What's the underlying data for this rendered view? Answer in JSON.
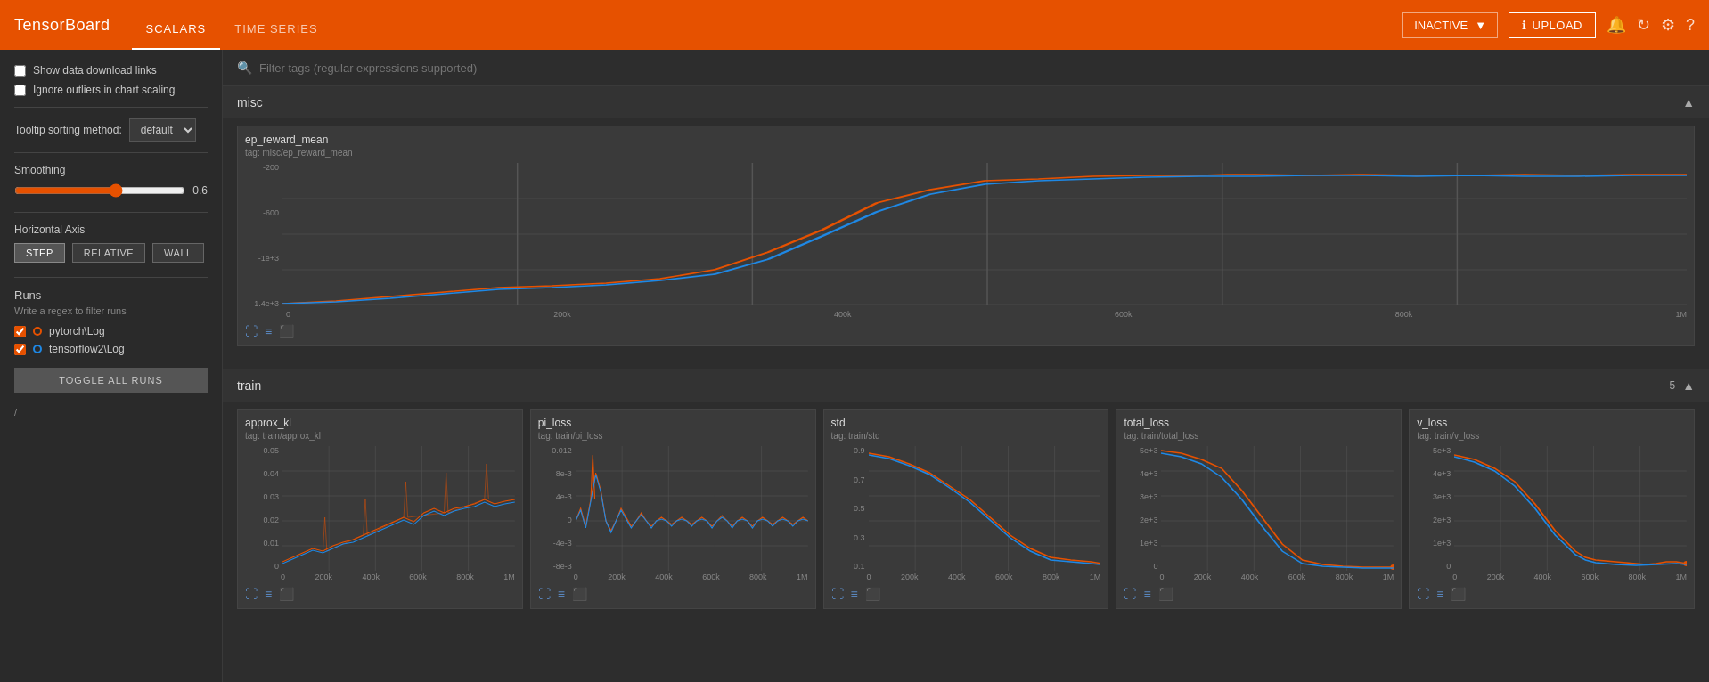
{
  "topnav": {
    "brand": "TensorBoard",
    "tabs": [
      {
        "label": "SCALARS",
        "active": true
      },
      {
        "label": "TIME SERIES",
        "active": false
      }
    ],
    "inactive_label": "INACTIVE",
    "upload_label": "UPLOAD",
    "icons": [
      "notification-icon",
      "refresh-icon",
      "settings-icon",
      "help-icon"
    ]
  },
  "sidebar": {
    "show_download": "Show data download links",
    "ignore_outliers": "Ignore outliers in chart scaling",
    "tooltip_label": "Tooltip sorting method:",
    "tooltip_value": "default",
    "smoothing_label": "Smoothing",
    "smoothing_value": "0.6",
    "haxis_label": "Horizontal Axis",
    "haxis_buttons": [
      "STEP",
      "RELATIVE",
      "WALL"
    ],
    "haxis_active": "STEP",
    "runs_title": "Runs",
    "runs_subtitle": "Write a regex to filter runs",
    "runs": [
      {
        "name": "pytorch\\Log",
        "color": "#e65100",
        "checked": true
      },
      {
        "name": "tensorflow2\\Log",
        "color": "#1e88e5",
        "checked": true
      }
    ],
    "toggle_all_label": "TOGGLE ALL RUNS",
    "slash_label": "/"
  },
  "filter": {
    "placeholder": "Filter tags (regular expressions supported)"
  },
  "sections": [
    {
      "title": "misc",
      "count": "",
      "collapsed": false,
      "charts": [
        {
          "id": "ep_reward_mean",
          "title": "ep_reward_mean",
          "tag": "tag: misc/ep_reward_mean",
          "y_labels": [
            "-200",
            "-600",
            "-1e+3",
            "-1.4e+3"
          ],
          "x_labels": [
            "0",
            "200k",
            "400k",
            "600k",
            "800k",
            "1M"
          ],
          "wide": true
        }
      ]
    },
    {
      "title": "train",
      "count": "5",
      "collapsed": false,
      "charts": [
        {
          "id": "approx_kl",
          "title": "approx_kl",
          "tag": "tag: train/approx_kl",
          "y_labels": [
            "0.05",
            "0.04",
            "0.03",
            "0.02",
            "0.01",
            "0"
          ],
          "x_labels": [
            "0",
            "200k",
            "400k",
            "600k",
            "800k",
            "1M"
          ]
        },
        {
          "id": "pi_loss",
          "title": "pi_loss",
          "tag": "tag: train/pi_loss",
          "y_labels": [
            "0.012",
            "8e-3",
            "4e-3",
            "0",
            "-4e-3",
            "-8e-3"
          ],
          "x_labels": [
            "0",
            "200k",
            "400k",
            "600k",
            "800k",
            "1M"
          ]
        },
        {
          "id": "std",
          "title": "std",
          "tag": "tag: train/std",
          "y_labels": [
            "0.9",
            "0.7",
            "0.5",
            "0.3",
            "0.1"
          ],
          "x_labels": [
            "0",
            "200k",
            "400k",
            "600k",
            "800k",
            "1M"
          ]
        },
        {
          "id": "total_loss",
          "title": "total_loss",
          "tag": "tag: train/total_loss",
          "y_labels": [
            "5e+3",
            "4e+3",
            "3e+3",
            "2e+3",
            "1e+3",
            "0"
          ],
          "x_labels": [
            "0",
            "200k",
            "400k",
            "600k",
            "800k",
            "1M"
          ]
        },
        {
          "id": "v_loss",
          "title": "v_loss",
          "tag": "tag: train/v_loss",
          "y_labels": [
            "5e+3",
            "4e+3",
            "3e+3",
            "2e+3",
            "1e+3",
            "0"
          ],
          "x_labels": [
            "0",
            "200k",
            "400k",
            "600k",
            "800k",
            "1M"
          ]
        }
      ]
    }
  ]
}
